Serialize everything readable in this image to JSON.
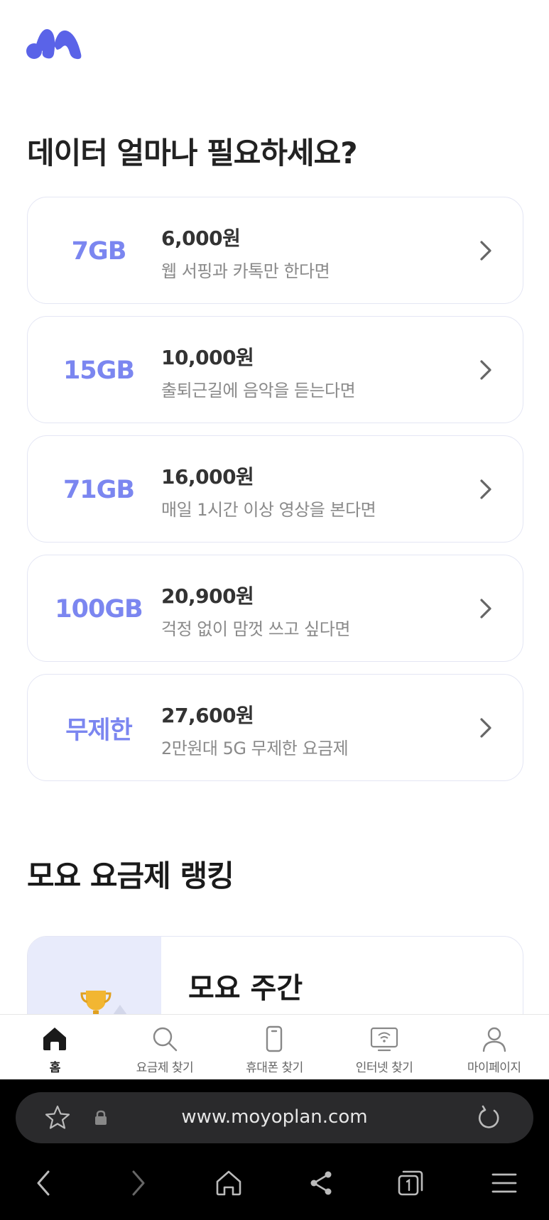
{
  "header": {
    "logo_icon": "moyo-logo"
  },
  "section1": {
    "title": "데이터 얼마나 필요하세요?"
  },
  "plans": [
    {
      "data": "7GB",
      "price": "6,000원",
      "desc": "웹 서핑과 카톡만 한다면"
    },
    {
      "data": "15GB",
      "price": "10,000원",
      "desc": "출퇴근길에 음악을 듣는다면"
    },
    {
      "data": "71GB",
      "price": "16,000원",
      "desc": "매일 1시간 이상 영상을 본다면"
    },
    {
      "data": "100GB",
      "price": "20,900원",
      "desc": "걱정 없이 맘껏 쓰고 싶다면"
    },
    {
      "data": "무제한",
      "price": "27,600원",
      "desc": "2만원대 5G 무제한 요금제"
    }
  ],
  "section2": {
    "title": "모요 요금제 랭킹",
    "card_title": "모요 주간"
  },
  "tabbar": {
    "items": [
      {
        "label": "홈",
        "icon": "home-icon",
        "active": true
      },
      {
        "label": "요금제 찾기",
        "icon": "search-icon",
        "active": false
      },
      {
        "label": "휴대폰 찾기",
        "icon": "phone-icon",
        "active": false
      },
      {
        "label": "인터넷 찾기",
        "icon": "wifi-tv-icon",
        "active": false
      },
      {
        "label": "마이페이지",
        "icon": "user-icon",
        "active": false
      }
    ]
  },
  "browser": {
    "url": "www.moyoplan.com"
  },
  "colors": {
    "accent": "#7b86f0",
    "logo": "#5a63e8"
  }
}
